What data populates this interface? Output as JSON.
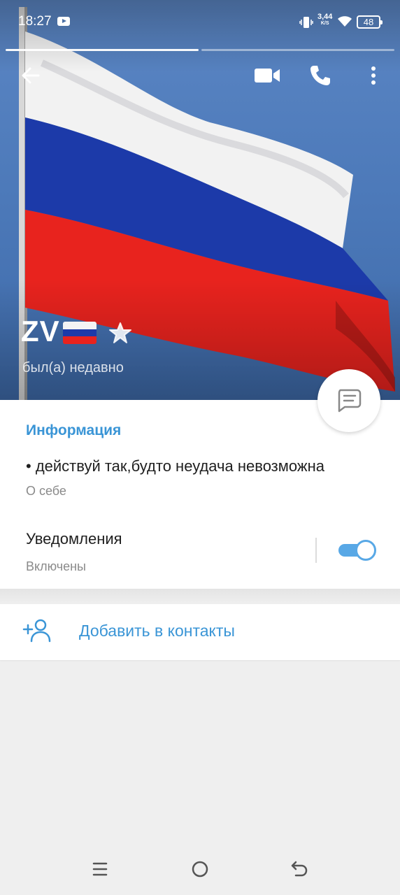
{
  "status_bar": {
    "time": "18:27",
    "net_speed": "3,44",
    "net_unit": "K/S",
    "battery": "48"
  },
  "profile": {
    "name": "ZV",
    "status": "был(а) недавно",
    "flag_colors": [
      "#ffffff",
      "#1c3aa9",
      "#e8231e"
    ]
  },
  "info": {
    "section_title": "Информация",
    "bio": "• действуй так,будто неудача невозможна",
    "bio_label": "О себе"
  },
  "notifications": {
    "title": "Уведомления",
    "state": "Включены",
    "enabled": true
  },
  "actions": {
    "add_contact": "Добавить в контакты"
  },
  "colors": {
    "accent": "#3a95d6",
    "toggle": "#58a8e6"
  },
  "icons": [
    "back-arrow-icon",
    "video-call-icon",
    "phone-icon",
    "more-vert-icon",
    "star-icon",
    "message-icon",
    "add-person-icon",
    "menu-icon",
    "home-icon",
    "back-icon"
  ]
}
